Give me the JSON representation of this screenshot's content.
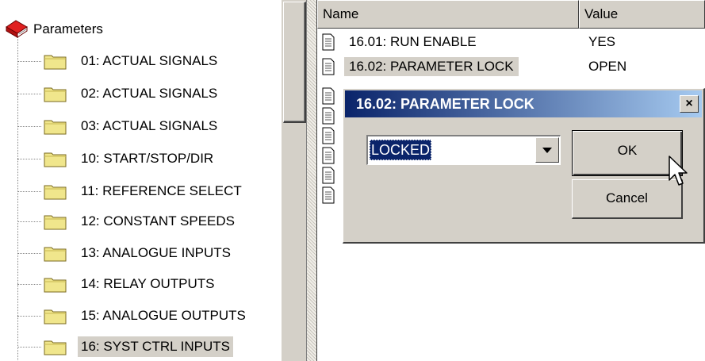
{
  "tree": {
    "root_label": "Parameters",
    "items": [
      {
        "label": "01: ACTUAL SIGNALS"
      },
      {
        "label": "02: ACTUAL SIGNALS"
      },
      {
        "label": "03: ACTUAL SIGNALS"
      },
      {
        "label": "10: START/STOP/DIR"
      },
      {
        "label": "11: REFERENCE SELECT"
      },
      {
        "label": "12: CONSTANT SPEEDS"
      },
      {
        "label": "13: ANALOGUE INPUTS"
      },
      {
        "label": "14: RELAY OUTPUTS"
      },
      {
        "label": "15: ANALOGUE OUTPUTS"
      },
      {
        "label": "16: SYST CTRL INPUTS"
      }
    ],
    "selected_index": 9
  },
  "list": {
    "columns": {
      "name": "Name",
      "value": "Value"
    },
    "rows": [
      {
        "name": "16.01: RUN ENABLE",
        "value": "YES"
      },
      {
        "name": "16.02: PARAMETER LOCK",
        "value": "OPEN"
      }
    ]
  },
  "dialog": {
    "title": "16.02: PARAMETER LOCK",
    "close_label": "×",
    "selected_option": "LOCKED",
    "ok_label": "OK",
    "cancel_label": "Cancel"
  },
  "icons": {
    "root": "parameters-book-icon",
    "folder": "folder-icon",
    "document": "document-icon",
    "cursor": "mouse-pointer-icon"
  },
  "colors": {
    "titlebar_start": "#0a246a",
    "titlebar_end": "#a6caf0",
    "face": "#d4d0c8",
    "folder": "#f0e68c"
  }
}
